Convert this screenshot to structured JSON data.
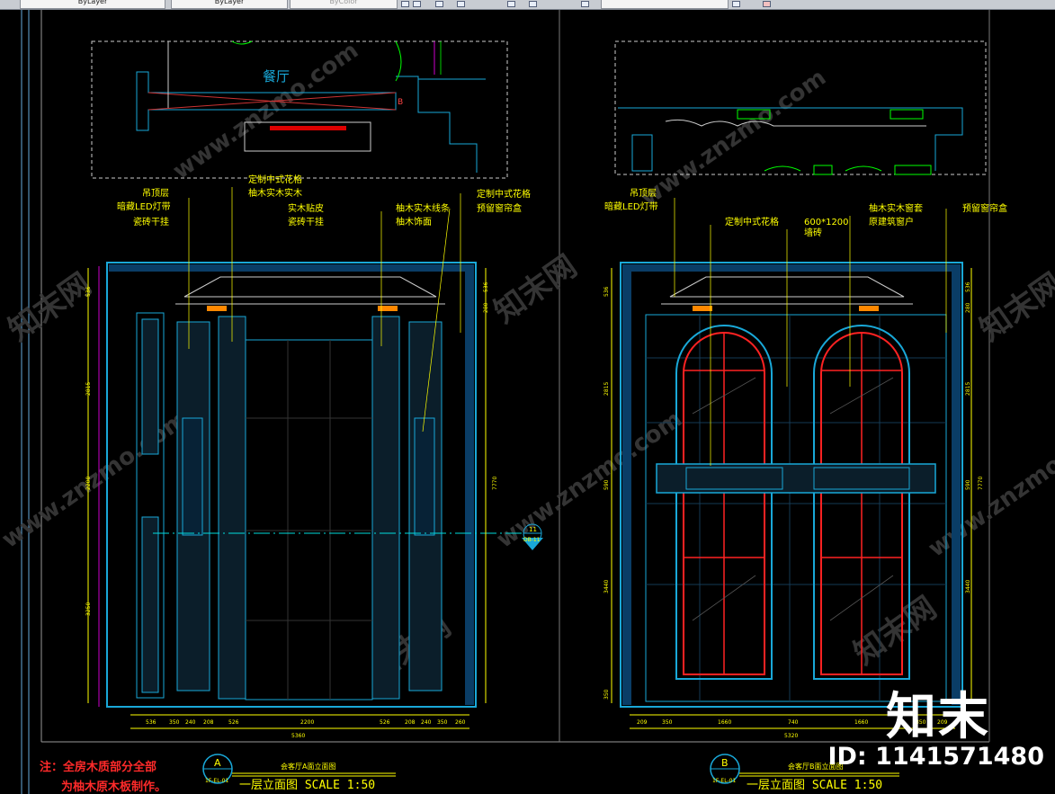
{
  "toolbar": {
    "layer_box_1": "ByLayer",
    "layer_box_2": "ByLayer",
    "layer_box_3": "ByColor",
    "icons": [
      "layer-icon",
      "save-icon",
      "properties-icon",
      "match-icon",
      "undo-icon",
      "redo-icon",
      "pencil-icon",
      "close-icon"
    ]
  },
  "plan": {
    "room_label": "餐厅",
    "annotation": "B"
  },
  "elevation_a": {
    "labels_left": [
      "吊顶层",
      "暗藏LED灯带",
      "瓷砖干挂"
    ],
    "labels_mid": [
      "定制中式花格",
      "柚木实木实木",
      "实木贴皮",
      "瓷砖干挂"
    ],
    "labels_right": [
      "柚木实木线条",
      "柚木饰面",
      "定制中式花格",
      "预留窗帘盒"
    ],
    "dims_bottom": [
      "536",
      "350",
      "240",
      "208",
      "526",
      "2200",
      "526",
      "208",
      "240",
      "350",
      "260"
    ],
    "dim_total": "5360",
    "dims_left": [
      "536",
      "2815",
      "2200",
      "3250"
    ],
    "dims_right": [
      "536",
      "280",
      "7770"
    ],
    "section_mark_num": "11",
    "section_mark_ref": "DB-11",
    "title_small": "会客厅A面立面图",
    "title_large": "一层立面图  SCALE 1:50",
    "circle_letter": "A",
    "circle_ref": "1F-EL-01"
  },
  "elevation_b": {
    "labels_left": [
      "吊顶层",
      "暗藏LED灯带"
    ],
    "labels_mid": [
      "定制中式花格",
      "600*1200",
      "墙砖"
    ],
    "labels_right": [
      "柚木实木窗套",
      "原建筑窗户",
      "预留窗帘盒"
    ],
    "dims_bottom": [
      "209",
      "350",
      "1660",
      "740",
      "1660",
      "350",
      "209"
    ],
    "dim_total": "5320",
    "dims_left": [
      "536",
      "2815",
      "590",
      "3440",
      "350"
    ],
    "dims_right": [
      "536",
      "280",
      "2815",
      "590",
      "3440",
      "7770"
    ],
    "title_small": "会客厅B面立面图",
    "title_large": "一层立面图  SCALE 1:50",
    "circle_letter": "B",
    "circle_ref": "1F-EL-01"
  },
  "note": {
    "line1": "注：全房木质部分全部",
    "line2": "为柚木原木板制作。"
  },
  "watermark": {
    "text_cn": "知末网",
    "text_en": "www.znzmo.com",
    "brand": "知末",
    "id_text": "ID: 1141571480"
  },
  "colors": {
    "background": "#000000",
    "annotation": "#ffff00",
    "structure": "#19a8d8",
    "window": "#ff2222",
    "furniture": "#00ff00",
    "note": "#ff2a2a"
  }
}
